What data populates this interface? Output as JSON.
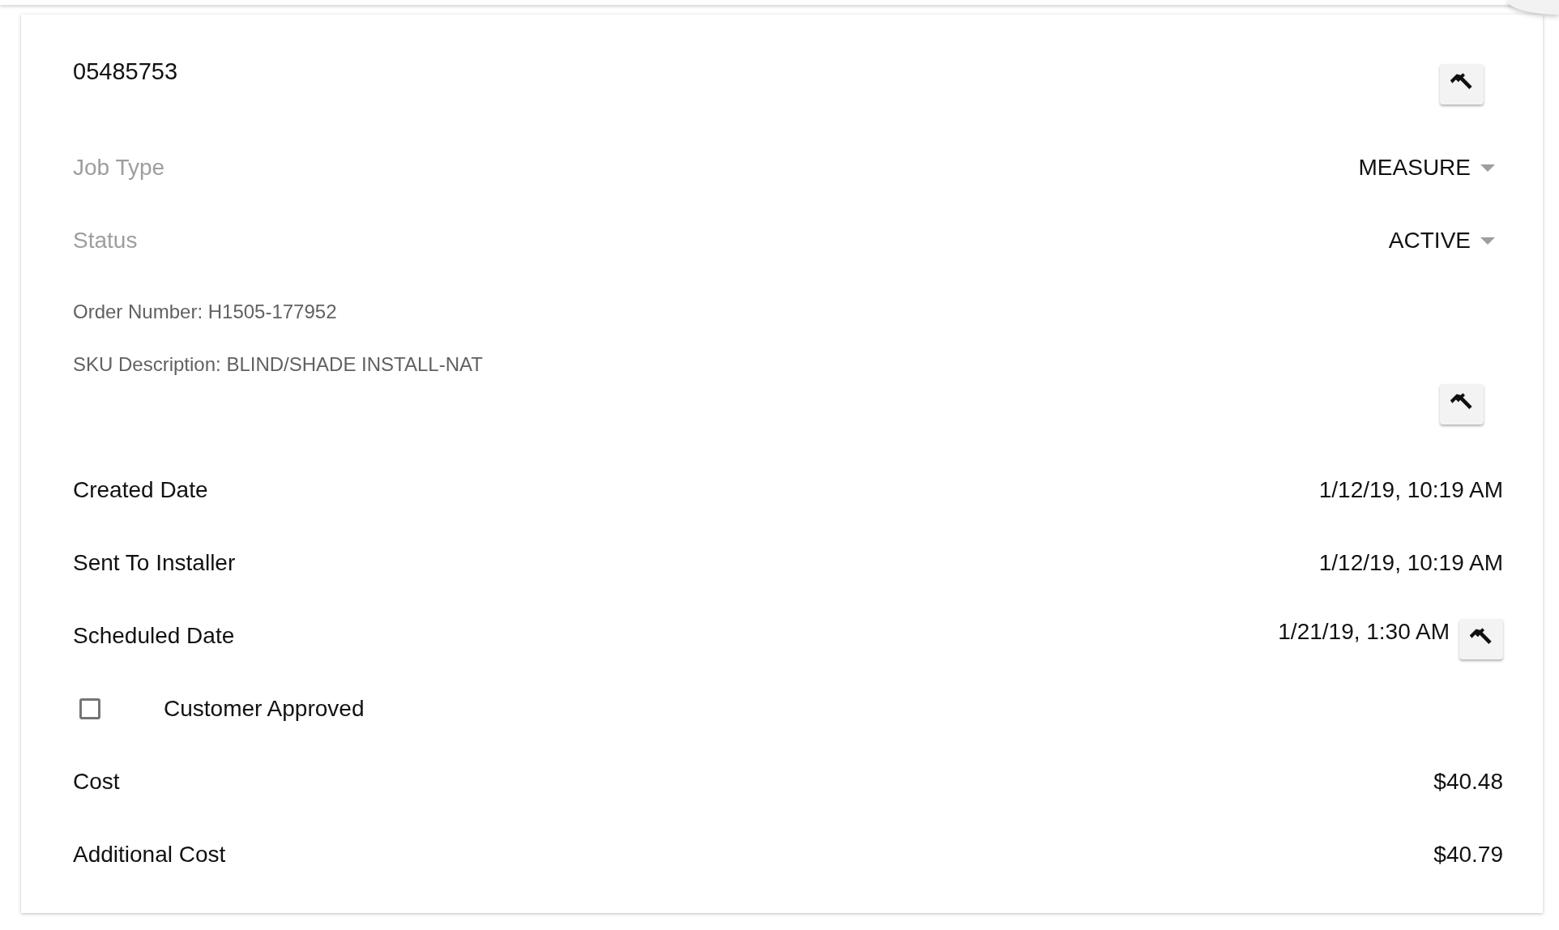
{
  "record_number": "05485753",
  "selects": [
    {
      "label": "Job Type",
      "value": "MEASURE"
    },
    {
      "label": "Status",
      "value": "ACTIVE"
    }
  ],
  "info_lines": [
    "Order Number: H1505-177952",
    "SKU Description: BLIND/SHADE INSTALL-NAT"
  ],
  "dates": [
    {
      "label": "Created Date",
      "value": "1/12/19, 10:19 AM",
      "editable": false
    },
    {
      "label": "Sent To Installer",
      "value": "1/12/19, 10:19 AM",
      "editable": false
    },
    {
      "label": "Scheduled Date",
      "value": "1/21/19, 1:30 AM",
      "editable": true
    }
  ],
  "customer_approved": {
    "label": "Customer Approved",
    "checked": false
  },
  "costs": [
    {
      "label": "Cost",
      "value": "$40.48"
    },
    {
      "label": "Additional Cost",
      "value": "$40.79"
    }
  ]
}
